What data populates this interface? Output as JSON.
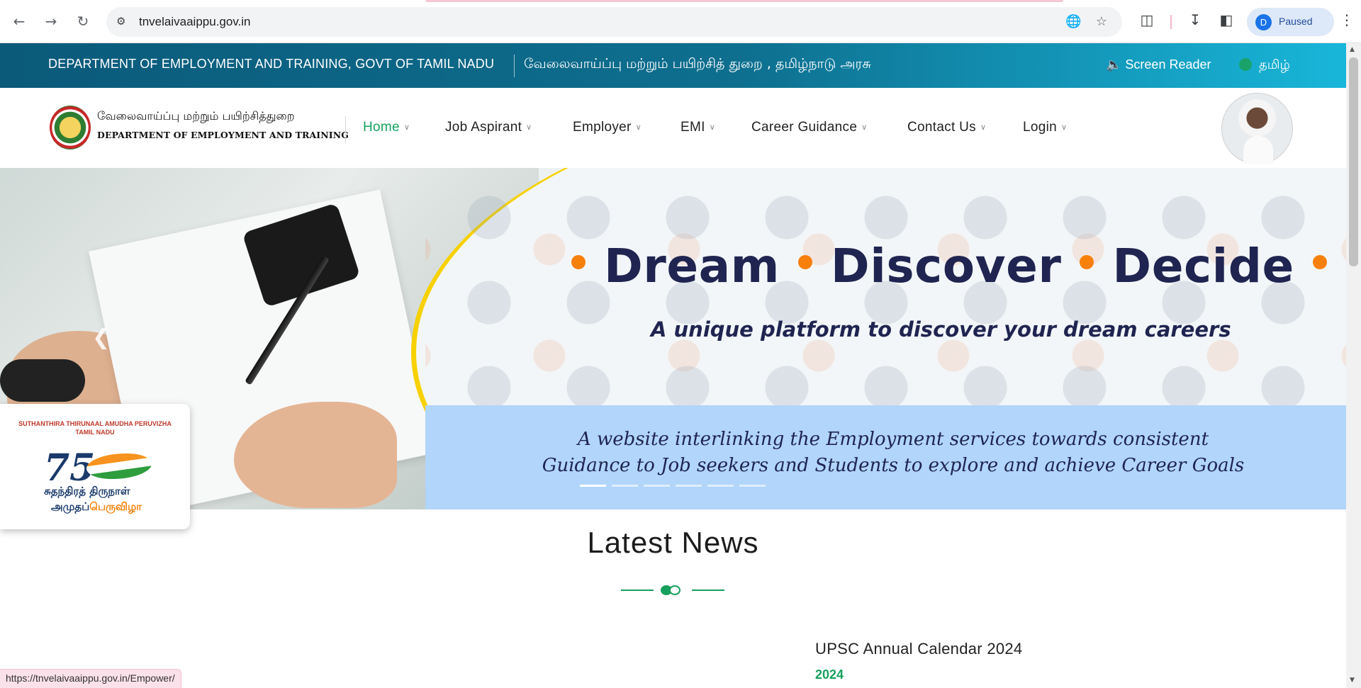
{
  "browser": {
    "url": "tnvelaivaaippu.gov.in",
    "profile_initial": "D",
    "profile_status": "Paused",
    "status_url": "https://tnvelaivaaippu.gov.in/Empower/"
  },
  "topbar": {
    "dept_en": "DEPARTMENT OF EMPLOYMENT AND TRAINING, GOVT OF TAMIL NADU",
    "dept_ta": "வேலைவாய்ப்பு மற்றும் பயிற்சித் துறை , தமிழ்நாடு அரசு",
    "screen_reader": "Screen Reader",
    "language": "தமிழ்"
  },
  "brand": {
    "tamil": "வேலைவாய்ப்பு மற்றும் பயிற்சித்துறை",
    "english": "DEPARTMENT OF EMPLOYMENT AND TRAINING"
  },
  "nav": {
    "items": [
      {
        "label": "Home",
        "active": true
      },
      {
        "label": "Job Aspirant"
      },
      {
        "label": "Employer"
      },
      {
        "label": "EMI"
      },
      {
        "label": "Career Guidance"
      },
      {
        "label": "Contact Us"
      },
      {
        "label": "Login"
      }
    ]
  },
  "hero": {
    "word1": "Dream",
    "word2": "Discover",
    "word3": "Decide",
    "subtitle": "A unique platform to discover your dream careers",
    "caption": "A website interlinking the Employment services towards consistent Guidance to Job seekers and Students to explore and achieve Career Goals",
    "slides_total": 6,
    "active_slide": 1
  },
  "badge75": {
    "line1": "SUTHANTHIRA THIRUNAAL AMUDHA PERUVIZHA",
    "line2": "TAMIL NADU",
    "number": "75",
    "tamil1": "சுதந்திரத் திருநாள்",
    "tamil2a": "அமுதப்",
    "tamil2b": "பெருவிழா"
  },
  "news": {
    "title": "Latest News",
    "item_title": "UPSC Annual Calendar 2024",
    "item_year": "2024"
  },
  "colors": {
    "accent_green": "#17a05d",
    "topbar_start": "#0b5a7a",
    "topbar_end": "#18b6d9",
    "headline_navy": "#1f2450",
    "dot_orange": "#f7800a",
    "ring_yellow": "#f7d100"
  }
}
